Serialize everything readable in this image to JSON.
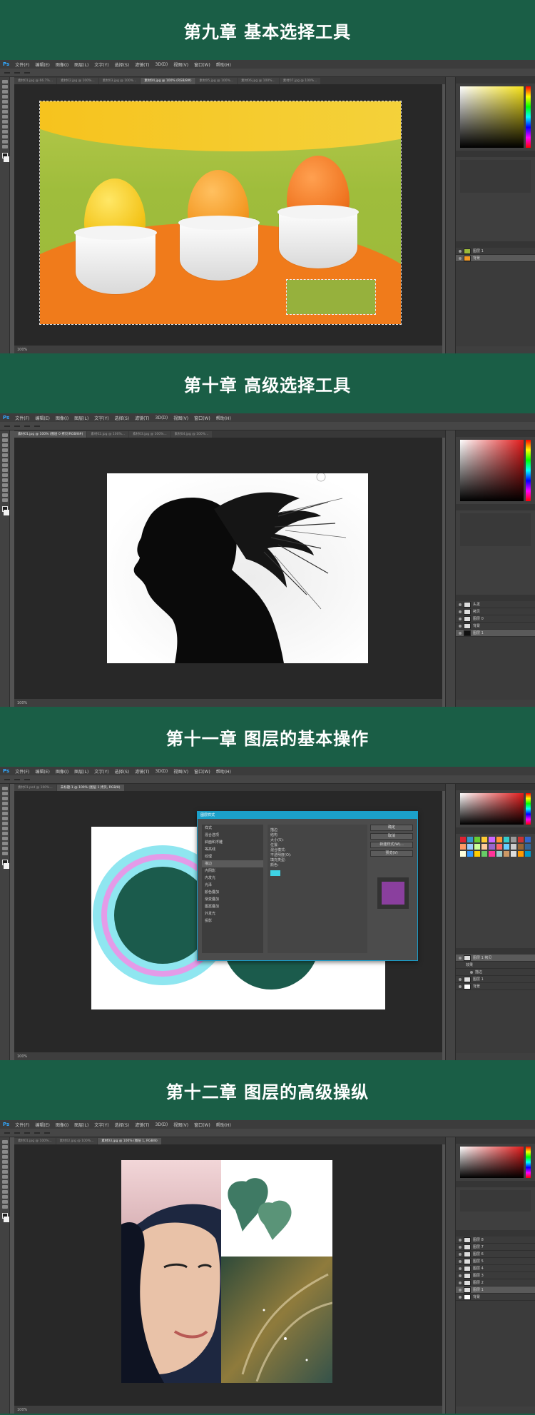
{
  "chapters": [
    {
      "title": "第九章 基本选择工具"
    },
    {
      "title": "第十章 高级选择工具"
    },
    {
      "title": "第十一章 图层的基本操作"
    },
    {
      "title": "第十二章 图层的高级操纵"
    }
  ],
  "app": {
    "logo": "Ps",
    "menu": [
      "文件(F)",
      "编辑(E)",
      "图像(I)",
      "图层(L)",
      "文字(Y)",
      "选择(S)",
      "滤镜(T)",
      "3D(D)",
      "视图(V)",
      "窗口(W)",
      "帮助(H)"
    ]
  },
  "ch1": {
    "tabs": [
      "素材01.jpg @ 66.7%...",
      "素材02.jpg @ 100%...",
      "素材03.jpg @ 100%...",
      "素材04.jpg @ 100% (RGB/8#)",
      "素材05.jpg @ 100%...",
      "素材06.jpg @ 100%...",
      "素材07.jpg @ 100%..."
    ],
    "status": "100%",
    "layers": [
      "图层 1",
      "背景"
    ]
  },
  "ch2": {
    "tabs": [
      "素材01.jpg @ 100% (图层 0 拷贝/RGB/8#)",
      "素材02.jpg @ 100%...",
      "素材03.jpg @ 100%...",
      "素材04.jpg @ 100%..."
    ],
    "status": "100%",
    "layers": [
      "头发",
      "拷贝",
      "图层 0",
      "背景",
      "图层 1"
    ]
  },
  "ch3": {
    "tabs": [
      "素材01.psd @ 100%...",
      "未标题-1 @ 100% (图层 1 拷贝, RGB/8)"
    ],
    "status": "100%",
    "dialog_title": "图层样式",
    "dialog_list": [
      "样式",
      "混合选项",
      "斜面和浮雕",
      "等高线",
      "纹理",
      "描边",
      "内阴影",
      "内发光",
      "光泽",
      "颜色叠加",
      "渐变叠加",
      "图案叠加",
      "外发光",
      "投影"
    ],
    "dialog_buttons": [
      "确定",
      "取消",
      "新建样式(W)...",
      "预览(V)"
    ],
    "dialog_mid": [
      "描边",
      "结构",
      "大小(S):",
      "位置:",
      "混合模式:",
      "不透明度(O):",
      "填充类型:",
      "颜色:"
    ],
    "layers": [
      "图层 1 拷贝",
      "效果",
      "描边",
      "图层 1",
      "背景"
    ]
  },
  "ch4": {
    "tabs": [
      "素材01.jpg @ 100%...",
      "素材02.jpg @ 100%...",
      "素材03.jpg @ 100% (图层 1, RGB/8)"
    ],
    "status": "100%",
    "layers": [
      "图层 8",
      "图层 7",
      "图层 6",
      "图层 5",
      "图层 4",
      "图层 3",
      "图层 2",
      "图层 1",
      "背景"
    ]
  },
  "colors": {
    "banner": "#1a5e46",
    "ps_panel": "#535353",
    "ring_cyan": "#8fe6f0",
    "ring_pink": "#e49be8",
    "ring_center": "#1b5b4c"
  }
}
